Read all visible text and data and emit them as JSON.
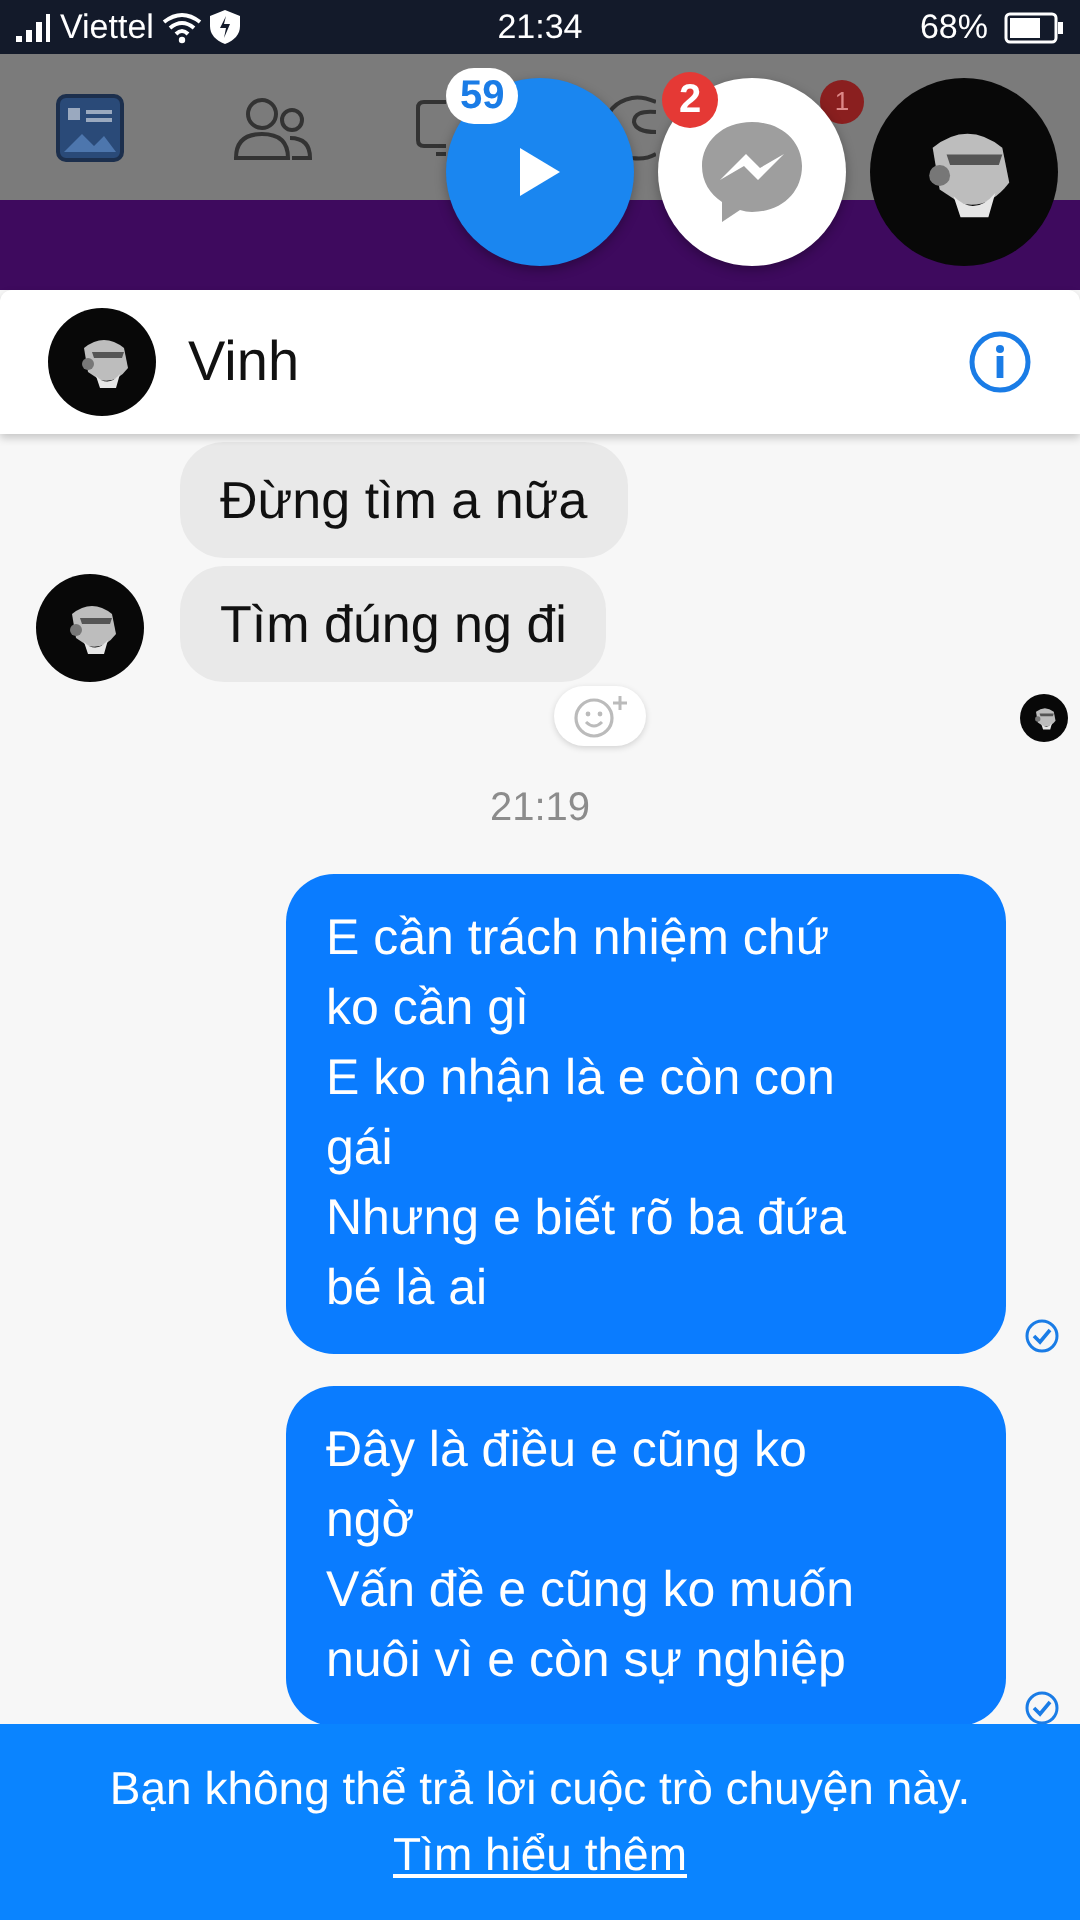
{
  "status_bar": {
    "carrier": "Viettel",
    "time": "21:34",
    "battery": "68%"
  },
  "nav_badge": "1",
  "chat_heads": [
    {
      "kind": "video",
      "badge": "59"
    },
    {
      "kind": "messenger",
      "badge": "2"
    },
    {
      "kind": "avatar"
    }
  ],
  "conversation": {
    "name": "Vinh"
  },
  "messages": [
    {
      "kind": "received",
      "text": "Đừng tìm a nữa",
      "avatar": false
    },
    {
      "kind": "received",
      "text": "Tìm đúng ng đi",
      "avatar": true,
      "reaction_button": true
    },
    {
      "kind": "seen"
    },
    {
      "kind": "time",
      "text": "21:19"
    },
    {
      "kind": "sent",
      "text": "E cần trách nhiệm chứ ko cần gì\nE ko nhận là e còn con gái\nNhưng e biết rõ ba đứa bé là ai",
      "delivered": true
    },
    {
      "kind": "sent",
      "text": "Đây là điều e cũng ko ngờ\nVấn đề e cũng ko muốn nuôi vì e còn sự nghiệp",
      "delivered": true
    }
  ],
  "footer": {
    "text": "Bạn không thể trả lời cuộc trò chuyện này.",
    "link": "Tìm hiểu thêm"
  }
}
